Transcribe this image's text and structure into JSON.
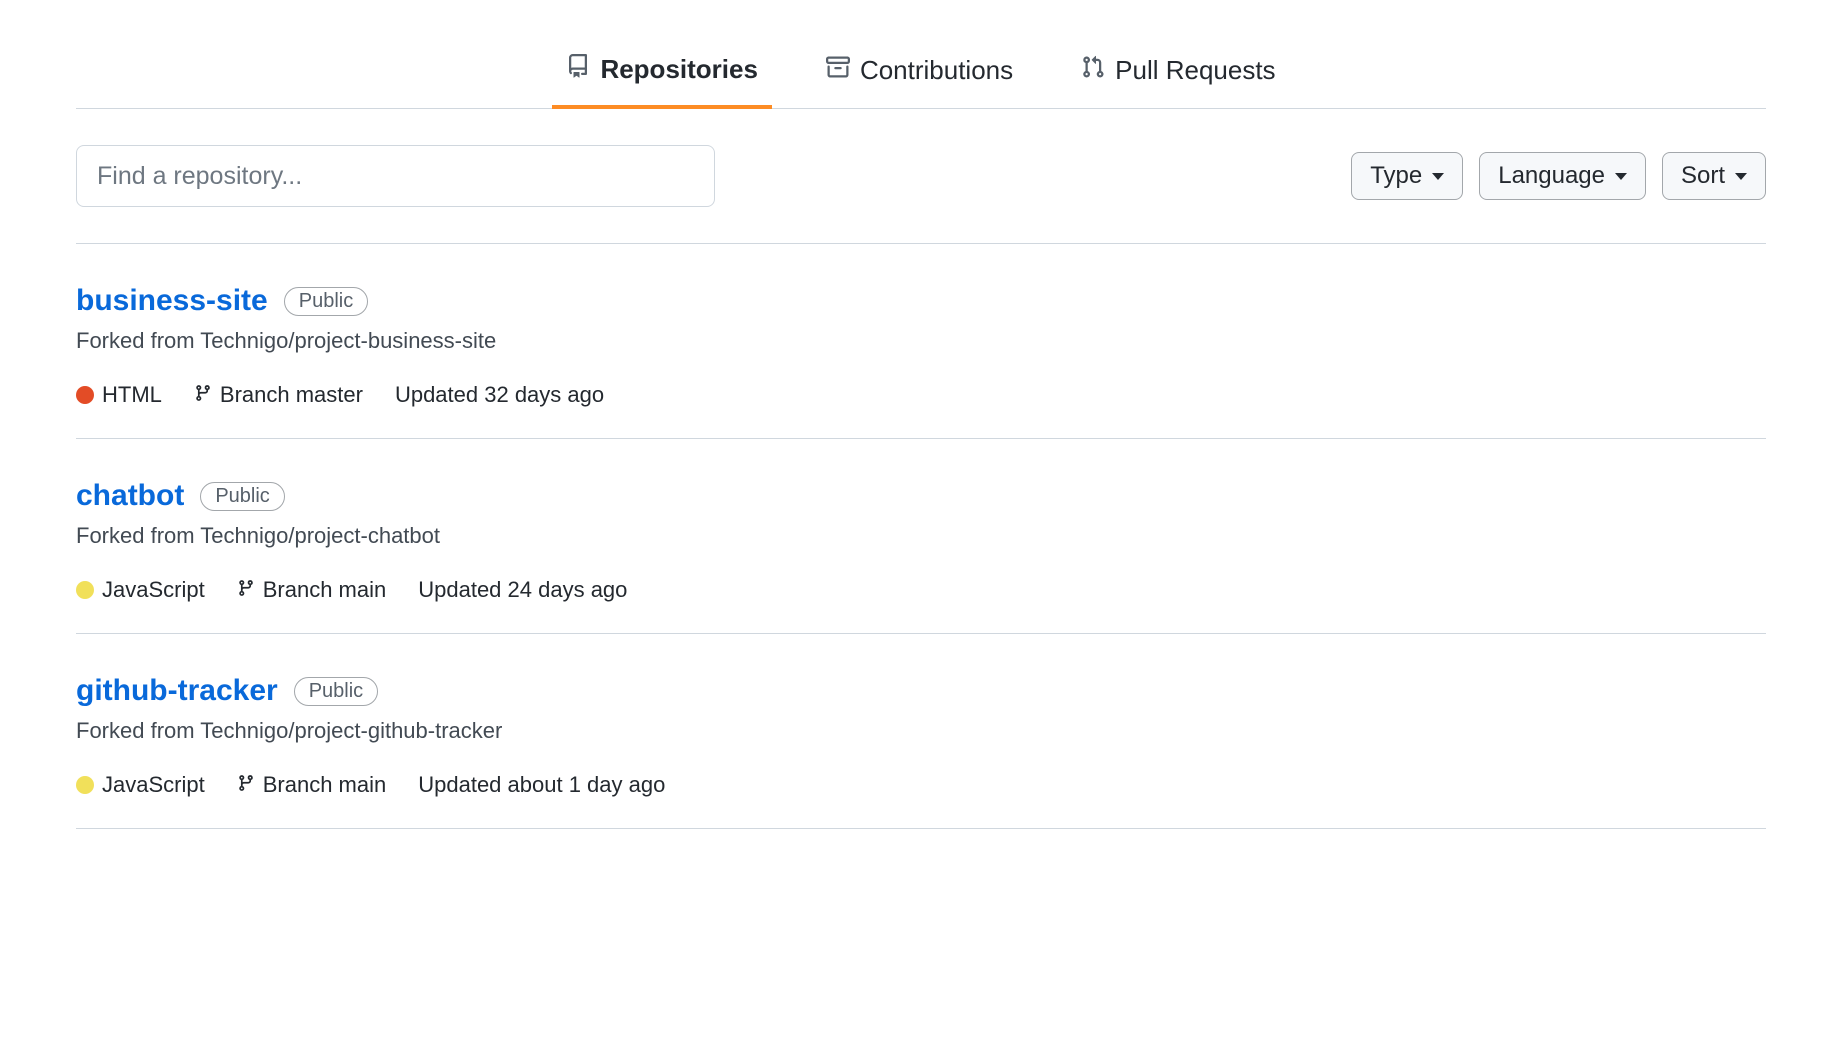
{
  "tabs": [
    {
      "label": "Repositories",
      "active": true,
      "icon": "repo-icon"
    },
    {
      "label": "Contributions",
      "active": false,
      "icon": "archive-icon"
    },
    {
      "label": "Pull Requests",
      "active": false,
      "icon": "pr-icon"
    }
  ],
  "search": {
    "placeholder": "Find a repository...",
    "value": ""
  },
  "filters": {
    "type_label": "Type",
    "language_label": "Language",
    "sort_label": "Sort"
  },
  "language_colors": {
    "HTML": "#e34c26",
    "JavaScript": "#f1e05a"
  },
  "repos": [
    {
      "name": "business-site",
      "visibility": "Public",
      "fork_text": "Forked from Technigo/project-business-site",
      "language": "HTML",
      "branch_label": "Branch master",
      "updated": "Updated 32 days ago"
    },
    {
      "name": "chatbot",
      "visibility": "Public",
      "fork_text": "Forked from Technigo/project-chatbot",
      "language": "JavaScript",
      "branch_label": "Branch main",
      "updated": "Updated 24 days ago"
    },
    {
      "name": "github-tracker",
      "visibility": "Public",
      "fork_text": "Forked from Technigo/project-github-tracker",
      "language": "JavaScript",
      "branch_label": "Branch main",
      "updated": "Updated about 1 day ago"
    }
  ]
}
